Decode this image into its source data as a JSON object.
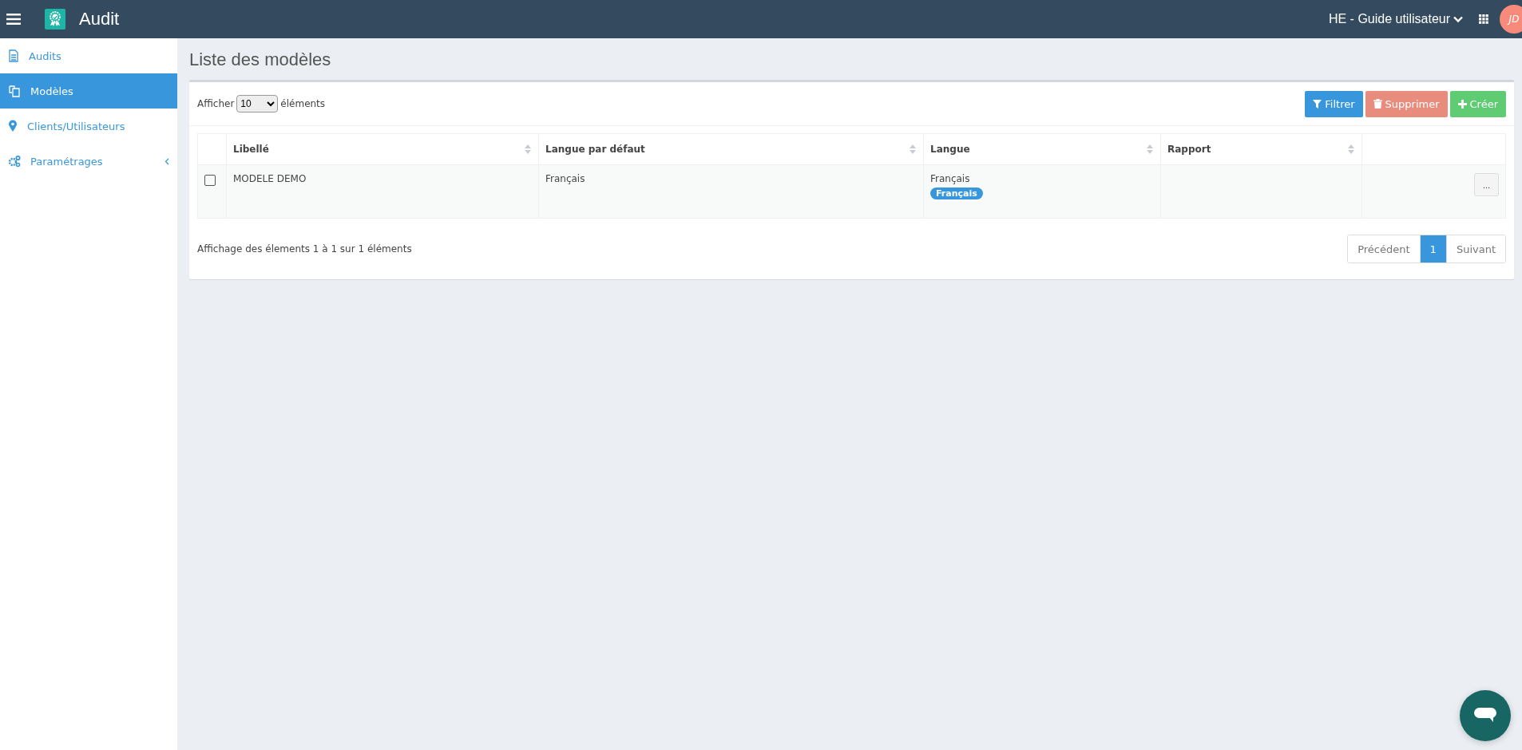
{
  "header": {
    "app_title": "Audit",
    "workspace": "HE - Guide utilisateur",
    "avatar_initials": "JD"
  },
  "sidebar": {
    "items": [
      {
        "label": "Audits",
        "selected": false
      },
      {
        "label": "Modèles",
        "selected": true
      },
      {
        "label": "Clients/Utilisateurs",
        "selected": false
      },
      {
        "label": "Paramétrages",
        "selected": false,
        "submenu": true
      }
    ]
  },
  "page_title": "Liste des modèles",
  "length_control": {
    "prefix": "Afficher",
    "value": "10",
    "suffix": "éléments"
  },
  "actions": [
    {
      "label": "Filtrer",
      "kind": "filter"
    },
    {
      "label": "Supprimer",
      "kind": "delete"
    },
    {
      "label": "Créer",
      "kind": "create"
    }
  ],
  "table": {
    "columns": [
      {
        "label": "Libellé",
        "sortable": true
      },
      {
        "label": "Langue par défaut",
        "sortable": true
      },
      {
        "label": "Langue",
        "sortable": true
      },
      {
        "label": "Rapport",
        "sortable": true
      }
    ],
    "rows": [
      {
        "checked": false,
        "libelle": "MODELE DEMO",
        "langue_defaut": "Français",
        "langue": "Français",
        "langue_badges": [
          "Français"
        ],
        "menu": "..."
      }
    ]
  },
  "info": "Affichage des élements 1 à 1 sur 1 éléments",
  "pagination": [
    {
      "label": "Précédent",
      "selected": false
    },
    {
      "label": "1",
      "selected": true
    },
    {
      "label": "Suivant",
      "selected": false
    }
  ]
}
